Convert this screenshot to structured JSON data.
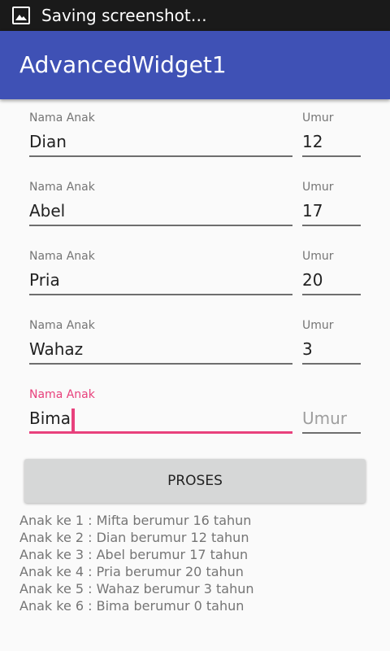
{
  "status_bar": {
    "text": "Saving screenshot…",
    "icon": "image-icon"
  },
  "app_bar": {
    "title": "AdvancedWidget1"
  },
  "form": {
    "rows": [
      {
        "name_label": "Nama Anak",
        "name_value": "Dian",
        "age_label": "Umur",
        "age_value": "12"
      },
      {
        "name_label": "Nama Anak",
        "name_value": "Abel",
        "age_label": "Umur",
        "age_value": "17"
      },
      {
        "name_label": "Nama Anak",
        "name_value": "Pria",
        "age_label": "Umur",
        "age_value": "20"
      },
      {
        "name_label": "Nama Anak",
        "name_value": "Wahaz",
        "age_label": "Umur",
        "age_value": "3"
      },
      {
        "name_label": "Nama Anak",
        "name_value": "Bima",
        "age_placeholder": "Umur"
      }
    ]
  },
  "button": {
    "label": "PROSES"
  },
  "results": [
    "Anak ke 1 : Mifta berumur 16 tahun",
    "Anak ke 2 : Dian berumur 12 tahun",
    "Anak ke 3 : Abel berumur 17 tahun",
    "Anak ke 4 : Pria berumur 20 tahun",
    "Anak ke 5 : Wahaz berumur 3 tahun",
    "Anak ke 6 : Bima berumur 0 tahun"
  ],
  "colors": {
    "primary": "#3f51b5",
    "accent": "#e8417c",
    "status_bar": "#1a1a1a",
    "button": "#d6d7d7"
  }
}
